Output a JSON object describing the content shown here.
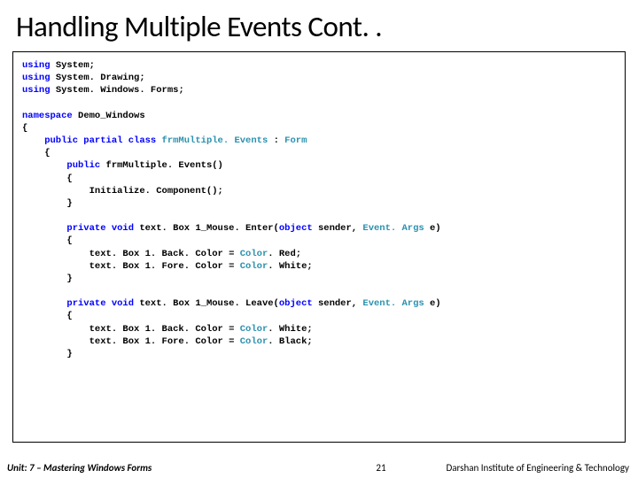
{
  "title": "Handling Multiple Events Cont. .",
  "code": {
    "l1a": "using",
    "l1b": " System;",
    "l2a": "using",
    "l2b": " System. Drawing;",
    "l3a": "using",
    "l3b": " System. Windows. Forms;",
    "l4a": "namespace",
    "l4b": " Demo_Windows",
    "l5": "{",
    "l6a": "    public partial class ",
    "l6b": "frmMultiple. Events ",
    "l6c": ": ",
    "l6d": "Form",
    "l7": "    {",
    "l8a": "        public",
    "l8b": " frmMultiple. Events()",
    "l9": "        {",
    "l10": "            Initialize. Component();",
    "l11": "        }",
    "l12a": "        private void",
    "l12b": " text. Box 1_Mouse. Enter(",
    "l12c": "object",
    "l12d": " sender, ",
    "l12e": "Event. Args",
    "l12f": " e)",
    "l13": "        {",
    "l14a": "            text. Box 1. Back. Color = ",
    "l14b": "Color",
    "l14c": ". Red;",
    "l15a": "            text. Box 1. Fore. Color = ",
    "l15b": "Color",
    "l15c": ". White;",
    "l16": "        }",
    "l17a": "        private void",
    "l17b": " text. Box 1_Mouse. Leave(",
    "l17c": "object",
    "l17d": " sender, ",
    "l17e": "Event. Args",
    "l17f": " e)",
    "l18": "        {",
    "l19a": "            text. Box 1. Back. Color = ",
    "l19b": "Color",
    "l19c": ". White;",
    "l20a": "            text. Box 1. Fore. Color = ",
    "l20b": "Color",
    "l20c": ". Black;",
    "l21": "        }"
  },
  "footer": {
    "unit_label": "Unit: 7 – ",
    "unit_title": "Mastering Windows Forms",
    "page": "21",
    "institute": "Darshan Institute of Engineering & Technology"
  }
}
